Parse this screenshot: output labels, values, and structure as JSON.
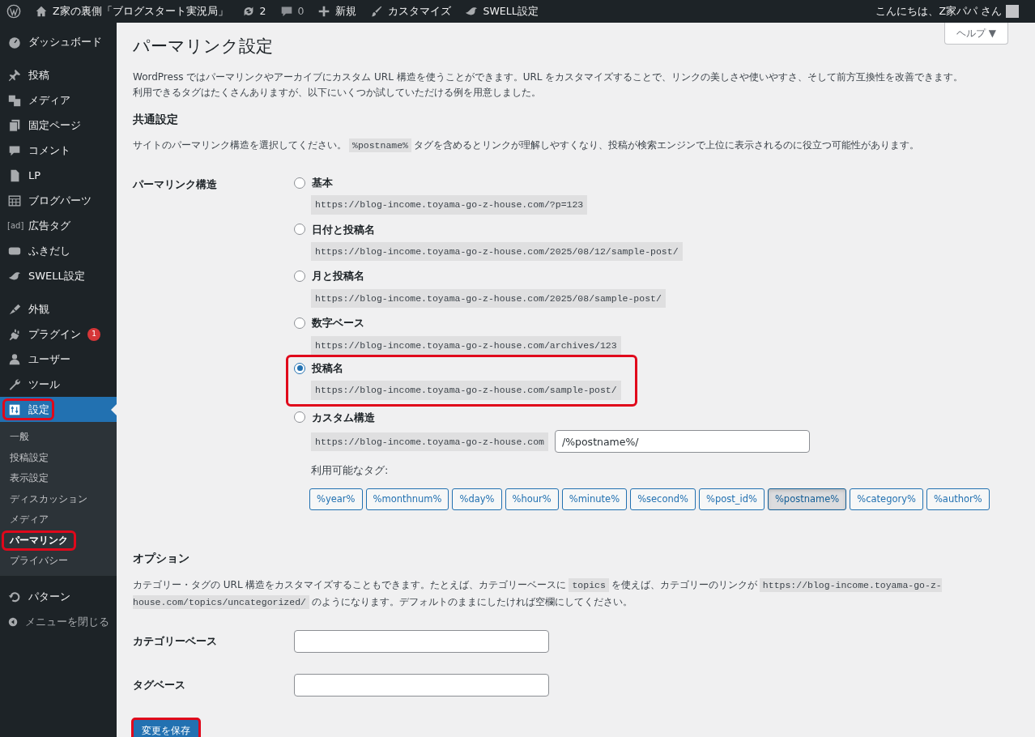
{
  "admin_bar": {
    "items": [
      {
        "kind": "wp-logo"
      },
      {
        "kind": "home",
        "label": "Z家の裏側「ブログスタート実況局」"
      },
      {
        "kind": "updates",
        "label": "2"
      },
      {
        "kind": "comments",
        "label": "0"
      },
      {
        "kind": "new",
        "label": "新規"
      },
      {
        "kind": "customize",
        "label": "カスタマイズ"
      },
      {
        "kind": "swell",
        "label": "SWELL設定"
      }
    ],
    "greeting": "こんにちは、Z家パパ さん"
  },
  "sidebar": {
    "groups": [
      [
        {
          "kind": "dashboard",
          "label": "ダッシュボード",
          "selected": false
        }
      ],
      [
        {
          "kind": "pin",
          "label": "投稿",
          "selected": false
        },
        {
          "kind": "media",
          "label": "メディア",
          "selected": false
        },
        {
          "kind": "pages",
          "label": "固定ページ",
          "selected": false
        },
        {
          "kind": "comment",
          "label": "コメント",
          "selected": false
        },
        {
          "kind": "doc",
          "label": "LP",
          "selected": false
        },
        {
          "kind": "grid",
          "label": "ブログパーツ",
          "selected": false
        },
        {
          "kind": "ad",
          "label": "広告タグ",
          "selected": false,
          "icon_text": "[ad]"
        },
        {
          "kind": "bubble",
          "label": "ふきだし",
          "selected": false
        },
        {
          "kind": "swell",
          "label": "SWELL設定",
          "selected": false
        }
      ],
      [
        {
          "kind": "brush",
          "label": "外観",
          "selected": false
        },
        {
          "kind": "plug",
          "label": "プラグイン",
          "selected": false,
          "badge": "1"
        },
        {
          "kind": "user",
          "label": "ユーザー",
          "selected": false
        },
        {
          "kind": "wrench",
          "label": "ツール",
          "selected": false
        },
        {
          "kind": "settings",
          "label": "設定",
          "selected": true,
          "highlighted": true,
          "children": [
            {
              "label": "一般",
              "selected": false,
              "highlighted": false
            },
            {
              "label": "投稿設定",
              "selected": false,
              "highlighted": false
            },
            {
              "label": "表示設定",
              "selected": false,
              "highlighted": false
            },
            {
              "label": "ディスカッション",
              "selected": false,
              "highlighted": false
            },
            {
              "label": "メディア",
              "selected": false,
              "highlighted": false
            },
            {
              "label": "パーマリンク",
              "selected": true,
              "highlighted": true
            },
            {
              "label": "プライバシー",
              "selected": false,
              "highlighted": false
            }
          ]
        }
      ],
      [
        {
          "kind": "undo",
          "label": "パターン",
          "selected": false
        },
        {
          "kind": "collapse",
          "label": "メニューを閉じる",
          "selected": false
        }
      ]
    ]
  },
  "help_button": "ヘルプ ▼",
  "page_title": "パーマリンク設定",
  "intro": {
    "text": "WordPress ではパーマリンクやアーカイブにカスタム URL 構造を使うことができます。URL をカスタマイズすることで、リンクの美しさや使いやすさ、そして前方互換性を改善できます。",
    "link": "利用できるタグはたくさんあります",
    "text_after": "が、以下にいくつか試していただける例を用意しました。"
  },
  "common": {
    "heading": "共通設定",
    "description": [
      {
        "kind": "text",
        "text": "サイトのパーマリンク構造を選択してください。"
      },
      {
        "kind": "code",
        "text": "%postname%"
      },
      {
        "kind": "text",
        "text": "タグを含めるとリンクが理解しやすくなり、投稿が検索エンジンで上位に表示されるのに役立つ可能性があります。"
      }
    ],
    "structure_label": "パーマリンク構造",
    "options": [
      {
        "kind": "preset",
        "label": "基本",
        "example": "https://blog-income.toyama-go-z-house.com/?p=123",
        "selected": false,
        "highlighted": false
      },
      {
        "kind": "preset",
        "label": "日付と投稿名",
        "example": "https://blog-income.toyama-go-z-house.com/2025/08/12/sample-post/",
        "selected": false,
        "highlighted": false
      },
      {
        "kind": "preset",
        "label": "月と投稿名",
        "example": "https://blog-income.toyama-go-z-house.com/2025/08/sample-post/",
        "selected": false,
        "highlighted": false
      },
      {
        "kind": "preset",
        "label": "数字ベース",
        "example": "https://blog-income.toyama-go-z-house.com/archives/123",
        "selected": false,
        "highlighted": false
      },
      {
        "kind": "preset",
        "label": "投稿名",
        "example": "https://blog-income.toyama-go-z-house.com/sample-post/",
        "selected": true,
        "highlighted": true
      },
      {
        "kind": "custom",
        "label": "カスタム構造",
        "prefix": "https://blog-income.toyama-go-z-house.com",
        "value": "/%postname%/",
        "selected": false,
        "highlighted": false,
        "tags_label": "利用可能なタグ:",
        "tags": [
          {
            "label": "%year%",
            "selected": false
          },
          {
            "label": "%monthnum%",
            "selected": false
          },
          {
            "label": "%day%",
            "selected": false
          },
          {
            "label": "%hour%",
            "selected": false
          },
          {
            "label": "%minute%",
            "selected": false
          },
          {
            "label": "%second%",
            "selected": false
          },
          {
            "label": "%post_id%",
            "selected": false
          },
          {
            "label": "%postname%",
            "selected": true
          },
          {
            "label": "%category%",
            "selected": false
          },
          {
            "label": "%author%",
            "selected": false
          }
        ]
      }
    ]
  },
  "optional": {
    "heading": "オプション",
    "description": [
      {
        "kind": "text",
        "text": "カテゴリー・タグの URL 構造をカスタマイズすることもできます。たとえば、カテゴリーベースに"
      },
      {
        "kind": "code",
        "text": "topics"
      },
      {
        "kind": "text",
        "text": "を使えば、カテゴリーのリンクが"
      },
      {
        "kind": "code",
        "text": "https://blog-income.toyama-go-z-house.com/topics/uncategorized/"
      },
      {
        "kind": "text",
        "text": "のようになります。デフォルトのままにしたければ空欄にしてください。"
      }
    ],
    "fields": [
      {
        "label": "カテゴリーベース"
      },
      {
        "label": "タグベース"
      }
    ]
  },
  "save_button": {
    "label": "変更を保存",
    "highlighted": true
  }
}
